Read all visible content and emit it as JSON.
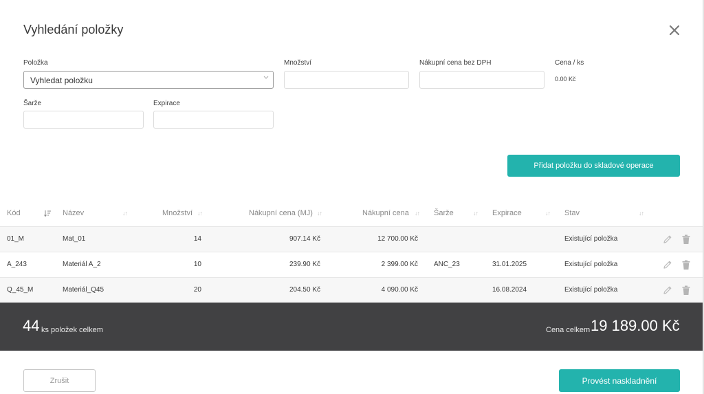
{
  "dialog": {
    "title": "Vyhledání položky"
  },
  "form": {
    "item_label": "Položka",
    "item_placeholder": "Vyhledat položku",
    "quantity_label": "Množství",
    "purchase_price_label": "Nákupní cena bez DPH",
    "unit_price_label": "Cena / ks",
    "unit_price_value": "0.00 Kč",
    "batch_label": "Šarže",
    "expiration_label": "Expirace",
    "add_button": "Přidat položku do skladové operace"
  },
  "table": {
    "columns": [
      "Kód",
      "Název",
      "Množství",
      "Nákupní cena (MJ)",
      "Nákupní cena",
      "Šarže",
      "Expirace",
      "Stav"
    ],
    "rows": [
      {
        "code": "01_M",
        "name": "Mat_01",
        "qty": "14",
        "unit_price": "907.14 Kč",
        "price": "12 700.00 Kč",
        "batch": "",
        "expiration": "",
        "state": "Existující položka"
      },
      {
        "code": "A_243",
        "name": "Materiál A_2",
        "qty": "10",
        "unit_price": "239.90 Kč",
        "price": "2 399.00 Kč",
        "batch": "ANC_23",
        "expiration": "31.01.2025",
        "state": "Existující položka"
      },
      {
        "code": "Q_45_M",
        "name": "Materiál_Q45",
        "qty": "20",
        "unit_price": "204.50 Kč",
        "price": "4 090.00 Kč",
        "batch": "",
        "expiration": "16.08.2024",
        "state": "Existující položka"
      }
    ],
    "row_icons": [
      "pencil-icon",
      "trash-icon"
    ]
  },
  "summary": {
    "count": "44",
    "count_label": "ks položek celkem",
    "total_label": "Cena celkem",
    "total_value": "19 189.00 Kč"
  },
  "footer": {
    "cancel_button": "Zrušit",
    "submit_button": "Provést naskladnění"
  },
  "colors": {
    "accent": "#23b3ad",
    "summary_bg": "#414143"
  }
}
